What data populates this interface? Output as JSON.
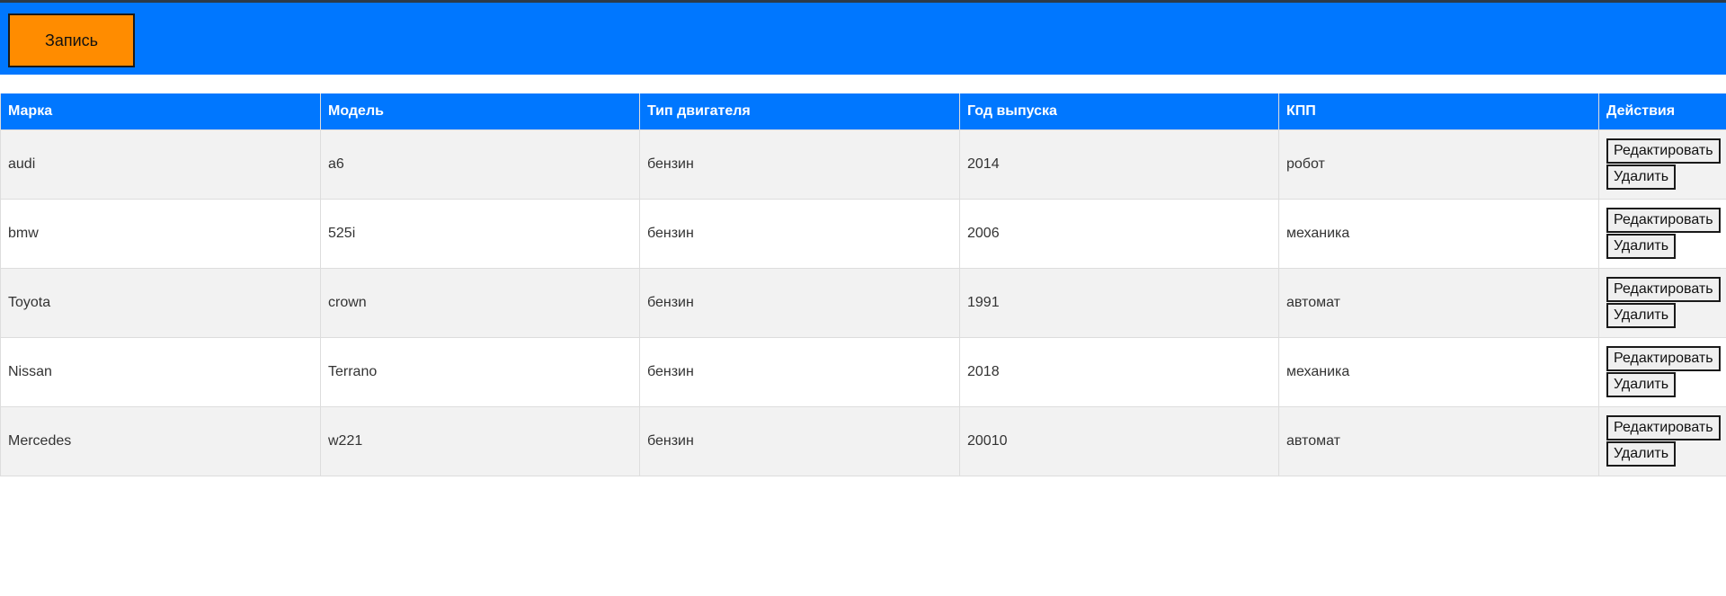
{
  "header": {
    "record_button_label": "Запись"
  },
  "table": {
    "columns": [
      "Марка",
      "Модель",
      "Тип двигателя",
      "Год выпуска",
      "КПП",
      "Действия"
    ],
    "rows": [
      {
        "brand": "audi",
        "model": "a6",
        "engine": "бензин",
        "year": "2014",
        "gearbox": "робот"
      },
      {
        "brand": "bmw",
        "model": "525i",
        "engine": "бензин",
        "year": "2006",
        "gearbox": "механика"
      },
      {
        "brand": "Toyota",
        "model": "crown",
        "engine": "бензин",
        "year": "1991",
        "gearbox": "автомат"
      },
      {
        "brand": "Nissan",
        "model": "Terrano",
        "engine": "бензин",
        "year": "2018",
        "gearbox": "механика"
      },
      {
        "brand": "Mercedes",
        "model": "w221",
        "engine": "бензин",
        "year": "20010",
        "gearbox": "автомат"
      }
    ],
    "actions": {
      "edit_label": "Редактировать",
      "delete_label": "Удалить"
    }
  },
  "colors": {
    "header_bg": "#0077ff",
    "record_button_bg": "#ff8c00",
    "row_alt_bg": "#f2f2f2"
  }
}
